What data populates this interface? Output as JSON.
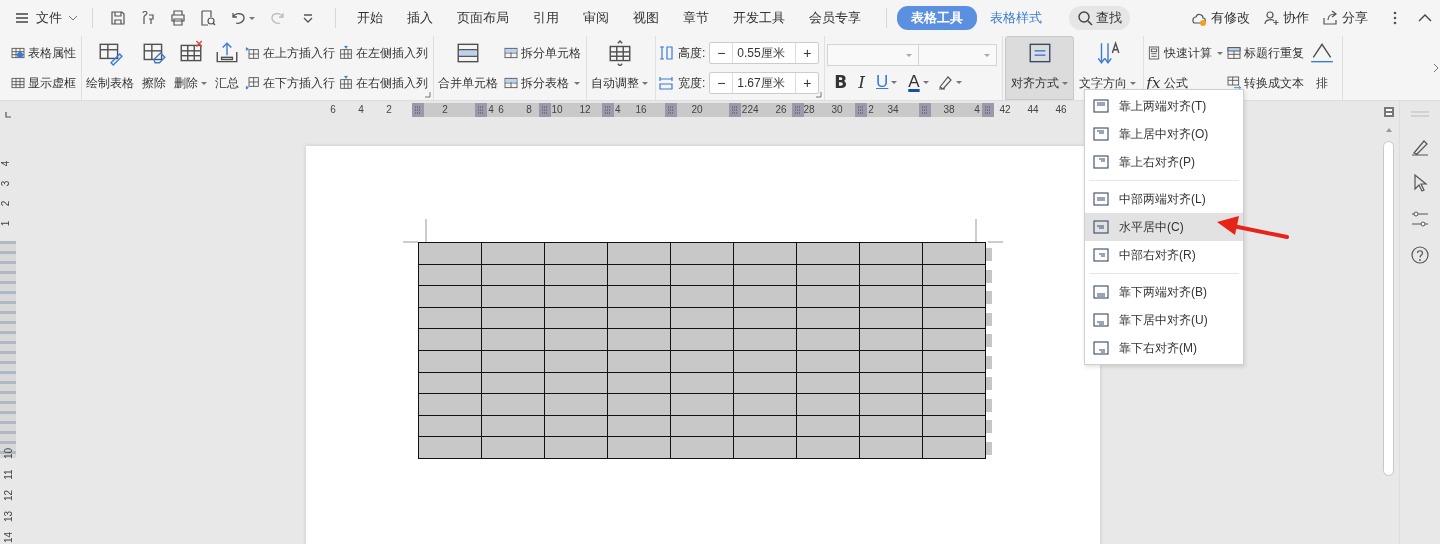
{
  "topbar": {
    "menu": {
      "label": "文件"
    },
    "tabs": [
      {
        "label": "开始",
        "selected": false,
        "contextual": false
      },
      {
        "label": "插入",
        "selected": false,
        "contextual": false
      },
      {
        "label": "页面布局",
        "selected": false,
        "contextual": false
      },
      {
        "label": "引用",
        "selected": false,
        "contextual": false
      },
      {
        "label": "审阅",
        "selected": false,
        "contextual": false
      },
      {
        "label": "视图",
        "selected": false,
        "contextual": false
      },
      {
        "label": "章节",
        "selected": false,
        "contextual": false
      },
      {
        "label": "开发工具",
        "selected": false,
        "contextual": false
      },
      {
        "label": "会员专享",
        "selected": false,
        "contextual": false
      },
      {
        "label": "表格工具",
        "selected": true,
        "contextual": true
      },
      {
        "label": "表格样式",
        "selected": false,
        "contextual": true
      }
    ],
    "search": {
      "label": "查找"
    },
    "actions": [
      {
        "label": "有修改"
      },
      {
        "label": "协作"
      },
      {
        "label": "分享"
      }
    ]
  },
  "ribbon": {
    "groups": [
      {
        "launcher": false,
        "controls": [
          {
            "kind": "stack",
            "items": [
              {
                "label": "表格属性",
                "has_menu": false
              },
              {
                "label": "显示虚框",
                "has_menu": false
              }
            ]
          }
        ]
      },
      {
        "launcher": true,
        "controls": [
          {
            "kind": "large",
            "label": "绘制表格",
            "has_menu": false,
            "selected": false
          },
          {
            "kind": "large",
            "label": "擦除",
            "has_menu": false,
            "selected": false
          },
          {
            "kind": "large",
            "label": "删除",
            "has_menu": true,
            "selected": false
          },
          {
            "kind": "large",
            "label": "汇总",
            "has_menu": false,
            "selected": false
          },
          {
            "kind": "stack",
            "items": [
              {
                "label": "在上方插入行",
                "has_menu": false
              },
              {
                "label": "在下方插入行",
                "has_menu": false
              }
            ]
          },
          {
            "kind": "stack",
            "items": [
              {
                "label": "在左侧插入列",
                "has_menu": false
              },
              {
                "label": "在右侧插入列",
                "has_menu": false
              }
            ]
          }
        ]
      },
      {
        "launcher": false,
        "controls": [
          {
            "kind": "large",
            "label": "合并单元格",
            "has_menu": false,
            "selected": false
          },
          {
            "kind": "stack",
            "items": [
              {
                "label": "拆分单元格",
                "has_menu": false
              },
              {
                "label": "拆分表格",
                "has_menu": true
              }
            ]
          }
        ]
      },
      {
        "launcher": false,
        "controls": [
          {
            "kind": "large",
            "label": "自动调整",
            "has_menu": true,
            "selected": false
          }
        ]
      },
      {
        "launcher": true,
        "controls": [
          {
            "kind": "measure",
            "rows": [
              {
                "label": "高度:",
                "minus": "−",
                "value": "0.55厘米",
                "plus": "+"
              },
              {
                "label": "宽度:",
                "minus": "−",
                "value": "1.67厘米",
                "plus": "+"
              }
            ]
          }
        ]
      },
      {
        "launcher": false,
        "controls": [
          {
            "kind": "font",
            "format": [
              {
                "text": "B",
                "has_menu": false
              },
              {
                "text": "I",
                "has_menu": false
              },
              {
                "text": "U",
                "has_menu": true
              },
              {
                "text": "A",
                "has_menu": true
              }
            ]
          }
        ]
      },
      {
        "launcher": false,
        "controls": [
          {
            "kind": "large",
            "label": "对齐方式",
            "has_menu": true,
            "selected": true
          },
          {
            "kind": "large",
            "label": "文字方向",
            "has_menu": true,
            "selected": false
          }
        ]
      },
      {
        "launcher": false,
        "controls": [
          {
            "kind": "stack",
            "items": [
              {
                "label": "快速计算",
                "has_menu": true
              },
              {
                "prefix": "fx",
                "label": "公式",
                "has_menu": false
              }
            ]
          },
          {
            "kind": "stack",
            "items": [
              {
                "label": "标题行重复",
                "has_menu": false
              },
              {
                "label": "转换成文本",
                "has_menu": false
              }
            ]
          },
          {
            "kind": "large",
            "label": "排",
            "has_menu": false,
            "selected": false
          }
        ]
      }
    ]
  },
  "ruler": {
    "marks": [
      {
        "kind": "number",
        "text": "6"
      },
      {
        "kind": "number",
        "text": "4"
      },
      {
        "kind": "number",
        "text": "2"
      },
      {
        "kind": "gap"
      },
      {
        "kind": "number",
        "text": "2"
      },
      {
        "kind": "number",
        "text": "4"
      },
      {
        "kind": "number",
        "text": "6"
      },
      {
        "kind": "number",
        "text": "8"
      },
      {
        "kind": "number",
        "text": "10"
      },
      {
        "kind": "number",
        "text": "12"
      },
      {
        "kind": "number",
        "text": "4"
      },
      {
        "kind": "number",
        "text": "16"
      },
      {
        "kind": "gap"
      },
      {
        "kind": "number",
        "text": "20"
      },
      {
        "kind": "number",
        "text": "2"
      },
      {
        "kind": "number",
        "text": "24"
      },
      {
        "kind": "number",
        "text": "26"
      },
      {
        "kind": "number",
        "text": "28"
      },
      {
        "kind": "number",
        "text": "30"
      },
      {
        "kind": "number",
        "text": "2"
      },
      {
        "kind": "number",
        "text": "34"
      },
      {
        "kind": "gap"
      },
      {
        "kind": "number",
        "text": "38"
      },
      {
        "kind": "number",
        "text": "4"
      },
      {
        "kind": "number",
        "text": "42"
      },
      {
        "kind": "number",
        "text": "44"
      },
      {
        "kind": "number",
        "text": "46"
      }
    ]
  },
  "vertical_ruler": {
    "upper": [
      "4",
      "3",
      "2",
      "1"
    ],
    "lower": [
      "10",
      "11",
      "12",
      "13",
      "14"
    ]
  },
  "table": {
    "rows": [
      {
        "cells": [
          {
            "selected": true
          },
          {
            "selected": true
          },
          {
            "selected": true
          },
          {
            "selected": true
          },
          {
            "selected": true
          },
          {
            "selected": true
          },
          {
            "selected": true
          },
          {
            "selected": true
          },
          {
            "selected": true
          }
        ]
      },
      {
        "cells": [
          {
            "selected": true
          },
          {
            "selected": true
          },
          {
            "selected": true
          },
          {
            "selected": true
          },
          {
            "selected": true
          },
          {
            "selected": true
          },
          {
            "selected": true
          },
          {
            "selected": true
          },
          {
            "selected": true
          }
        ]
      },
      {
        "cells": [
          {
            "selected": true
          },
          {
            "selected": true
          },
          {
            "selected": true
          },
          {
            "selected": true
          },
          {
            "selected": true
          },
          {
            "selected": true
          },
          {
            "selected": true
          },
          {
            "selected": true
          },
          {
            "selected": true
          }
        ]
      },
      {
        "cells": [
          {
            "selected": true
          },
          {
            "selected": true
          },
          {
            "selected": true
          },
          {
            "selected": true
          },
          {
            "selected": true
          },
          {
            "selected": true
          },
          {
            "selected": true
          },
          {
            "selected": true
          },
          {
            "selected": true
          }
        ]
      },
      {
        "cells": [
          {
            "selected": true
          },
          {
            "selected": true
          },
          {
            "selected": true
          },
          {
            "selected": true
          },
          {
            "selected": true
          },
          {
            "selected": true
          },
          {
            "selected": true
          },
          {
            "selected": true
          },
          {
            "selected": true
          }
        ]
      },
      {
        "cells": [
          {
            "selected": true
          },
          {
            "selected": true
          },
          {
            "selected": true
          },
          {
            "selected": true
          },
          {
            "selected": true
          },
          {
            "selected": true
          },
          {
            "selected": true
          },
          {
            "selected": true
          },
          {
            "selected": true
          }
        ]
      },
      {
        "cells": [
          {
            "selected": true
          },
          {
            "selected": true
          },
          {
            "selected": true
          },
          {
            "selected": true
          },
          {
            "selected": true
          },
          {
            "selected": true
          },
          {
            "selected": true
          },
          {
            "selected": true
          },
          {
            "selected": true
          }
        ]
      },
      {
        "cells": [
          {
            "selected": true
          },
          {
            "selected": true
          },
          {
            "selected": true
          },
          {
            "selected": true
          },
          {
            "selected": true
          },
          {
            "selected": true
          },
          {
            "selected": true
          },
          {
            "selected": true
          },
          {
            "selected": true
          }
        ]
      },
      {
        "cells": [
          {
            "selected": true
          },
          {
            "selected": true
          },
          {
            "selected": true
          },
          {
            "selected": true
          },
          {
            "selected": true
          },
          {
            "selected": true
          },
          {
            "selected": true
          },
          {
            "selected": true
          },
          {
            "selected": true
          }
        ]
      },
      {
        "cells": [
          {
            "selected": true
          },
          {
            "selected": true
          },
          {
            "selected": true
          },
          {
            "selected": true
          },
          {
            "selected": true
          },
          {
            "selected": true
          },
          {
            "selected": true
          },
          {
            "selected": true
          },
          {
            "selected": true
          }
        ]
      }
    ]
  },
  "align_menu": {
    "groups": [
      {
        "items": [
          {
            "label": "靠上两端对齐(T)",
            "selected": false
          },
          {
            "label": "靠上居中对齐(O)",
            "selected": false
          },
          {
            "label": "靠上右对齐(P)",
            "selected": false
          }
        ]
      },
      {
        "items": [
          {
            "label": "中部两端对齐(L)",
            "selected": false
          },
          {
            "label": "水平居中(C)",
            "selected": true
          },
          {
            "label": "中部右对齐(R)",
            "selected": false
          }
        ]
      },
      {
        "items": [
          {
            "label": "靠下两端对齐(B)",
            "selected": false
          },
          {
            "label": "靠下居中对齐(U)",
            "selected": false
          },
          {
            "label": "靠下右对齐(M)",
            "selected": false
          }
        ]
      }
    ]
  }
}
